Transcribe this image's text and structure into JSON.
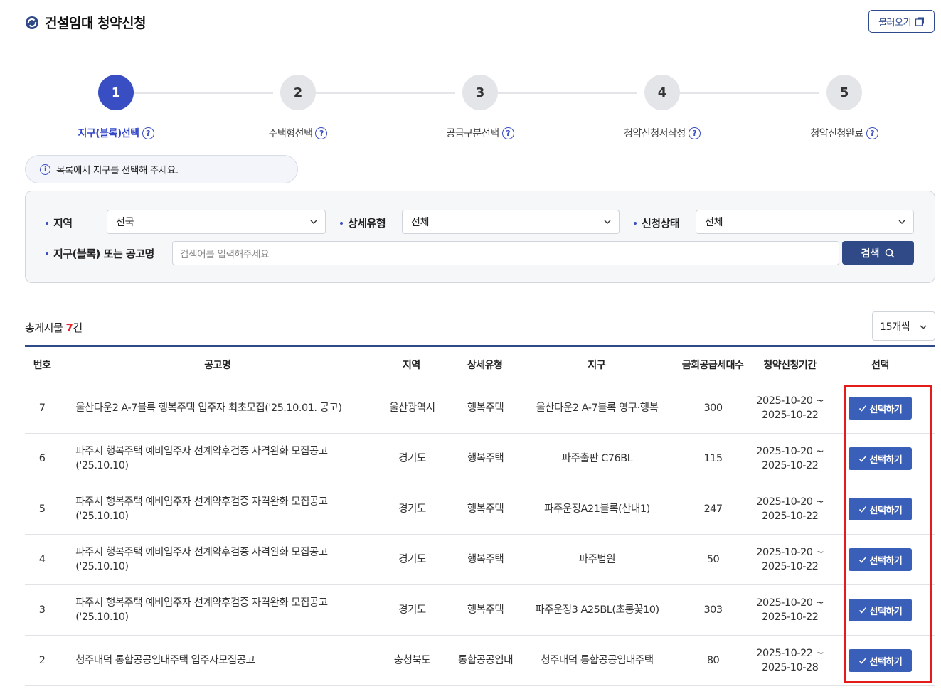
{
  "header": {
    "title": "건설임대 청약신청",
    "load_button": "불러오기"
  },
  "stepper": {
    "steps": [
      {
        "num": "1",
        "label": "지구(블록)선택"
      },
      {
        "num": "2",
        "label": "주택형선택"
      },
      {
        "num": "3",
        "label": "공급구분선택"
      },
      {
        "num": "4",
        "label": "청약신청서작성"
      },
      {
        "num": "5",
        "label": "청약신청완료"
      }
    ],
    "active": 1
  },
  "info": {
    "message": "목록에서 지구를 선택해 주세요.",
    "icon": "i"
  },
  "filters": {
    "region_label": "지역",
    "region_value": "전국",
    "detail_label": "상세유형",
    "detail_value": "전체",
    "status_label": "신청상태",
    "status_value": "전체",
    "keyword_label": "지구(블록) 또는 공고명",
    "keyword_placeholder": "검색어를 입력해주세요",
    "search_button": "검색"
  },
  "results": {
    "prefix": "총게시물 ",
    "count": "7",
    "suffix": "건",
    "per_page": "15개씩"
  },
  "table": {
    "headers": {
      "no": "번호",
      "title": "공고명",
      "region": "지역",
      "type": "상세유형",
      "district": "지구",
      "count": "금회공급세대수",
      "period": "청약신청기간",
      "select": "선택"
    },
    "select_label": "선택하기",
    "rows": [
      {
        "no": "7",
        "title": "울산다운2 A-7블록 행복주택 입주자 최초모집('25.10.01. 공고)",
        "region": "울산광역시",
        "type": "행복주택",
        "district": "울산다운2 A-7블록 영구·행복",
        "count": "300",
        "period_start": "2025-10-20 ~",
        "period_end": "2025-10-22"
      },
      {
        "no": "6",
        "title": "파주시 행복주택 예비입주자 선계약후검증 자격완화 모집공고 ('25.10.10)",
        "region": "경기도",
        "type": "행복주택",
        "district": "파주출판 C76BL",
        "count": "115",
        "period_start": "2025-10-20 ~",
        "period_end": "2025-10-22"
      },
      {
        "no": "5",
        "title": "파주시 행복주택 예비입주자 선계약후검증 자격완화 모집공고 ('25.10.10)",
        "region": "경기도",
        "type": "행복주택",
        "district": "파주운정A21블록(산내1)",
        "count": "247",
        "period_start": "2025-10-20 ~",
        "period_end": "2025-10-22"
      },
      {
        "no": "4",
        "title": "파주시 행복주택 예비입주자 선계약후검증 자격완화 모집공고 ('25.10.10)",
        "region": "경기도",
        "type": "행복주택",
        "district": "파주법원",
        "count": "50",
        "period_start": "2025-10-20 ~",
        "period_end": "2025-10-22"
      },
      {
        "no": "3",
        "title": "파주시 행복주택 예비입주자 선계약후검증 자격완화 모집공고 ('25.10.10)",
        "region": "경기도",
        "type": "행복주택",
        "district": "파주운정3 A25BL(초롱꽃10)",
        "count": "303",
        "period_start": "2025-10-20 ~",
        "period_end": "2025-10-22"
      },
      {
        "no": "2",
        "title": "청주내덕 통합공공임대주택 입주자모집공고",
        "region": "충청북도",
        "type": "통합공공임대",
        "district": "청주내덕 통합공공임대주택",
        "count": "80",
        "period_start": "2025-10-22 ~",
        "period_end": "2025-10-28"
      }
    ]
  },
  "colors": {
    "accent": "#3a4ec4",
    "navy": "#2f4a86",
    "button": "#3a5fb8",
    "highlight": "#e41b1b",
    "count_red": "#e2262b"
  }
}
